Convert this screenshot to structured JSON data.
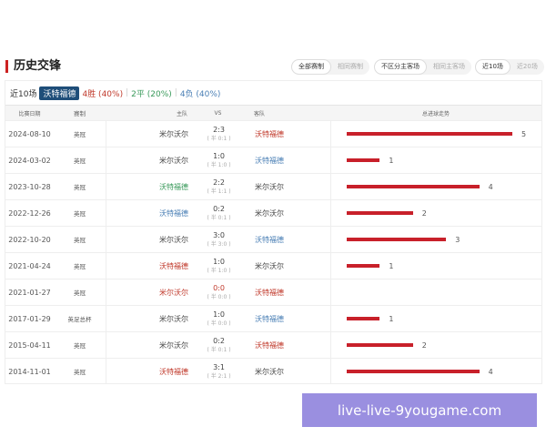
{
  "title": "历史交锋",
  "filters": [
    [
      "全部赛制",
      "相同赛制"
    ],
    [
      "不区分主客场",
      "相同主客场"
    ],
    [
      "近10场",
      "近20场"
    ]
  ],
  "summary": {
    "label": "近10场",
    "team": "沃特福德",
    "win": "4胜 (40%)",
    "draw": "2平 (20%)",
    "loss": "4负 (40%)",
    "sep": "|",
    "colors": {
      "win": "#c0392b",
      "draw": "#3a9a5b",
      "loss": "#4a7fb5"
    }
  },
  "headers": [
    "比赛日期",
    "赛制",
    "主队",
    "VS",
    "客队",
    "总进球走势"
  ],
  "rows": [
    {
      "date": "2024-08-10",
      "comp": "英冠",
      "home": "米尔沃尔",
      "score": "2:3",
      "half": "( 半 0:1 )",
      "away": "沃特福德",
      "hc": "#444",
      "ac": "#c0392b",
      "sc": "#444",
      "goals": 5
    },
    {
      "date": "2024-03-02",
      "comp": "英冠",
      "home": "米尔沃尔",
      "score": "1:0",
      "half": "( 半 1:0 )",
      "away": "沃特福德",
      "hc": "#444",
      "ac": "#4a7fb5",
      "sc": "#444",
      "goals": 1
    },
    {
      "date": "2023-10-28",
      "comp": "英冠",
      "home": "沃特福德",
      "score": "2:2",
      "half": "( 半 1:1 )",
      "away": "米尔沃尔",
      "hc": "#3a9a5b",
      "ac": "#444",
      "sc": "#444",
      "goals": 4
    },
    {
      "date": "2022-12-26",
      "comp": "英冠",
      "home": "沃特福德",
      "score": "0:2",
      "half": "( 半 0:1 )",
      "away": "米尔沃尔",
      "hc": "#4a7fb5",
      "ac": "#444",
      "sc": "#444",
      "goals": 2
    },
    {
      "date": "2022-10-20",
      "comp": "英冠",
      "home": "米尔沃尔",
      "score": "3:0",
      "half": "( 半 3:0 )",
      "away": "沃特福德",
      "hc": "#444",
      "ac": "#4a7fb5",
      "sc": "#444",
      "goals": 3
    },
    {
      "date": "2021-04-24",
      "comp": "英冠",
      "home": "沃特福德",
      "score": "1:0",
      "half": "( 半 1:0 )",
      "away": "米尔沃尔",
      "hc": "#c0392b",
      "ac": "#444",
      "sc": "#444",
      "goals": 1
    },
    {
      "date": "2021-01-27",
      "comp": "英冠",
      "home": "米尔沃尔",
      "score": "0:0",
      "half": "( 半 0:0 )",
      "away": "沃特福德",
      "hc": "#c0392b",
      "ac": "#c0392b",
      "sc": "#c0392b",
      "goals": 0
    },
    {
      "date": "2017-01-29",
      "comp": "英足总杯",
      "home": "米尔沃尔",
      "score": "1:0",
      "half": "( 半 0:0 )",
      "away": "沃特福德",
      "hc": "#444",
      "ac": "#4a7fb5",
      "sc": "#444",
      "goals": 1
    },
    {
      "date": "2015-04-11",
      "comp": "英冠",
      "home": "米尔沃尔",
      "score": "0:2",
      "half": "( 半 0:1 )",
      "away": "沃特福德",
      "hc": "#444",
      "ac": "#c0392b",
      "sc": "#444",
      "goals": 2
    },
    {
      "date": "2014-11-01",
      "comp": "英冠",
      "home": "沃特福德",
      "score": "3:1",
      "half": "( 半 2:1 )",
      "away": "米尔沃尔",
      "hc": "#c0392b",
      "ac": "#444",
      "sc": "#444",
      "goals": 4
    }
  ],
  "watermark": "live-live-9yougame.com"
}
